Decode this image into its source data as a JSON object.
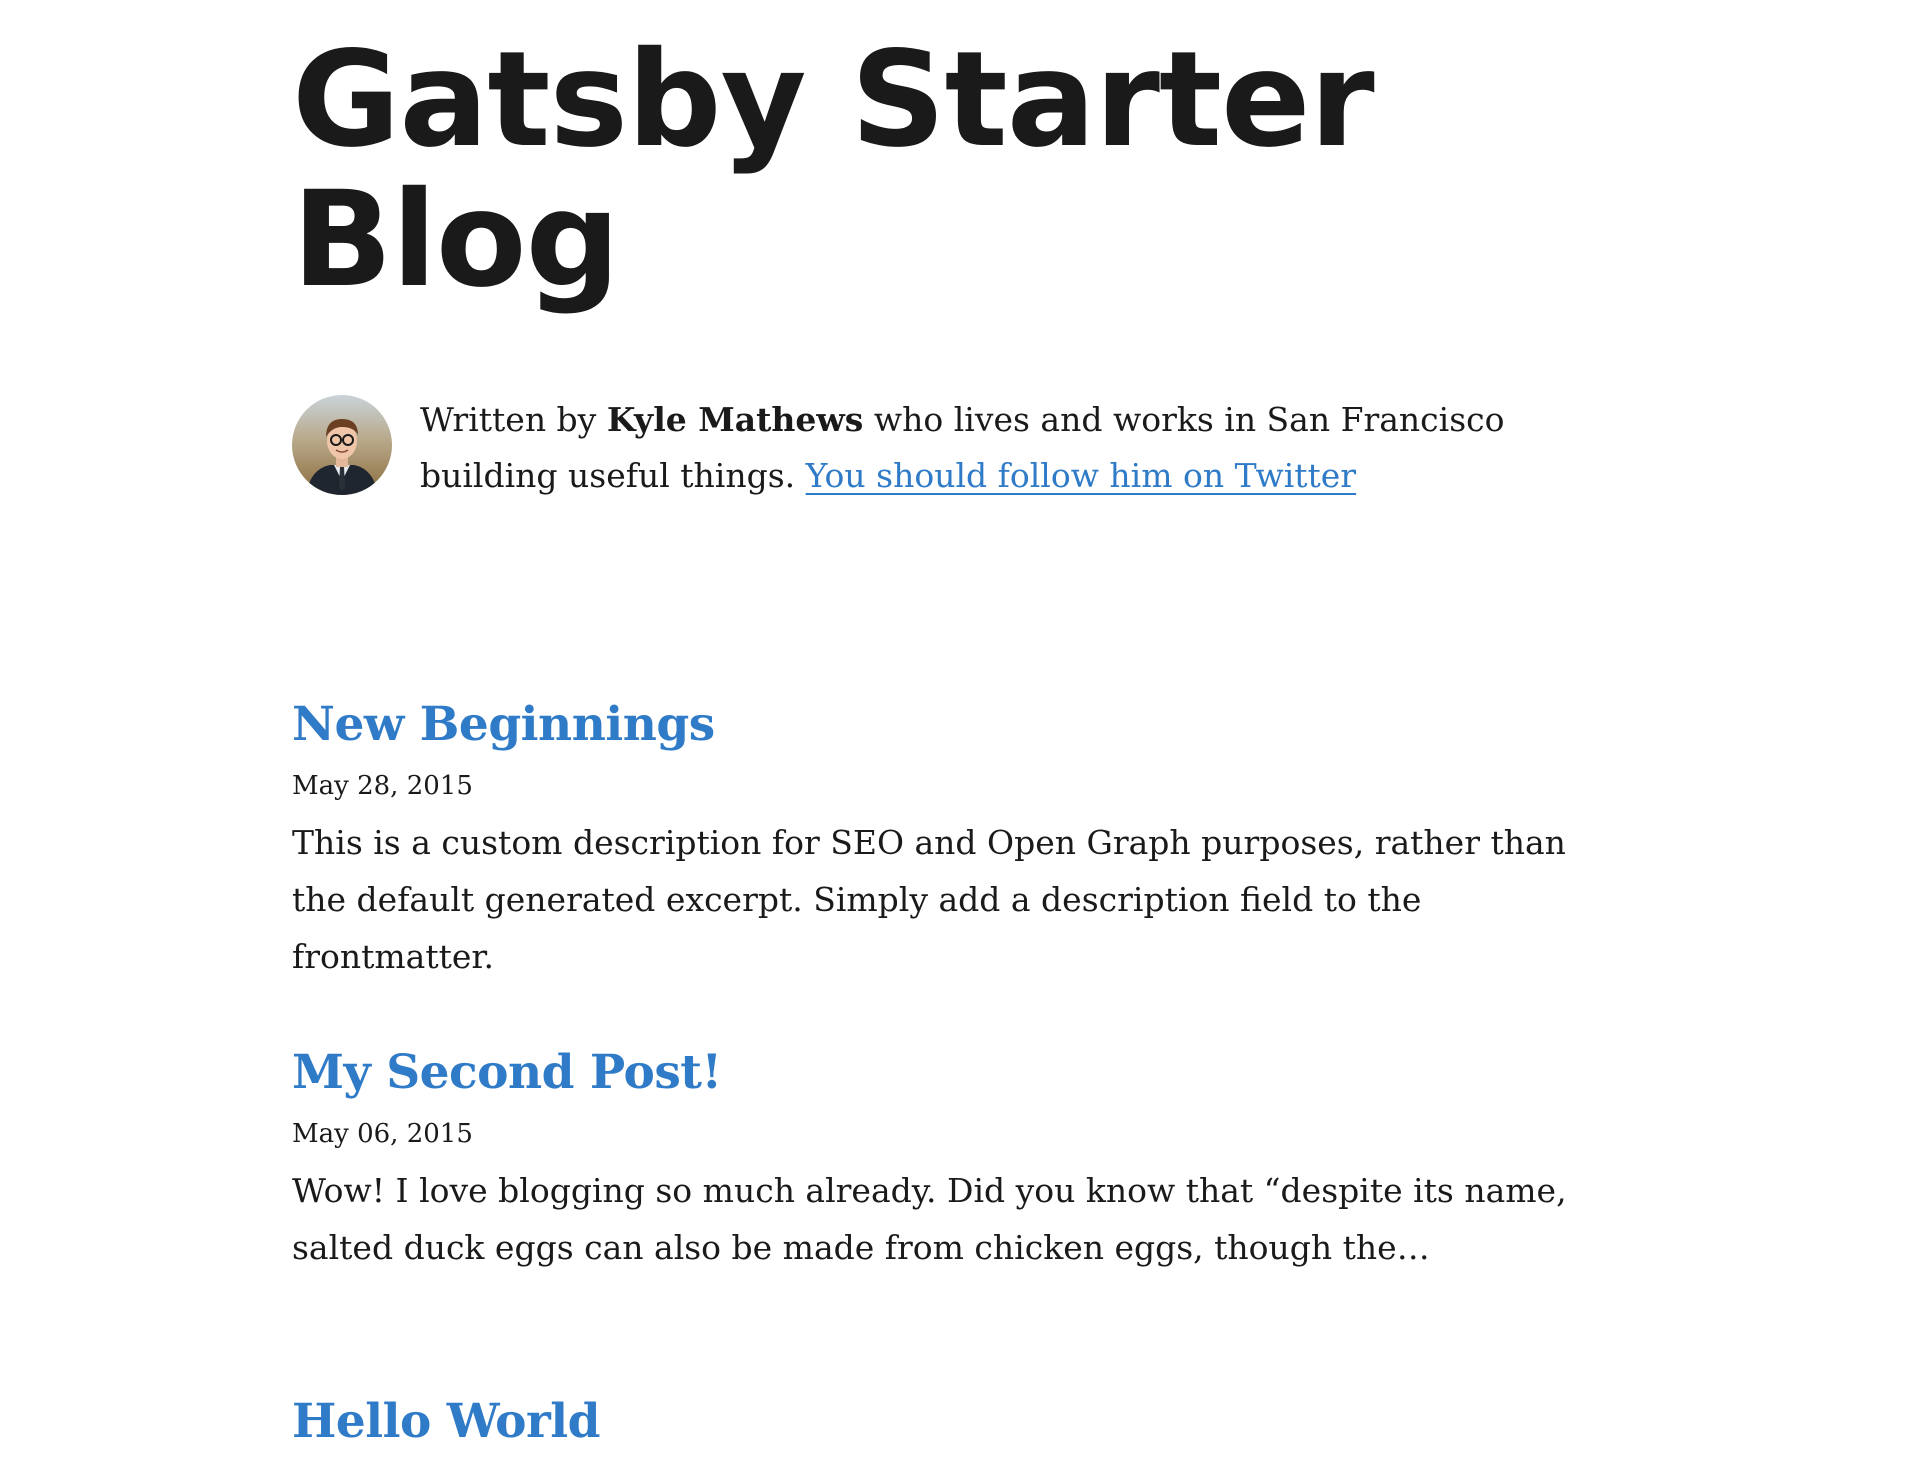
{
  "header": {
    "title": "Gatsby Starter Blog"
  },
  "bio": {
    "prefix": "Written by ",
    "author": "Kyle Mathews",
    "suffix": " who lives and works in San Francisco building useful things. ",
    "link_label": "You should follow him on Twitter"
  },
  "posts": [
    {
      "title": "New Beginnings",
      "date": "May 28, 2015",
      "excerpt": "This is a custom description for SEO and Open Graph purposes, rather than the default generated excerpt. Simply add a description field to the frontmatter."
    },
    {
      "title": "My Second Post!",
      "date": "May 06, 2015",
      "excerpt": "Wow! I love blogging so much already. Did you know that “despite its name, salted duck eggs can also be made from chicken eggs, though the…"
    },
    {
      "title": "Hello World",
      "date": "",
      "excerpt": ""
    }
  ],
  "colors": {
    "link": "#2f7bc7",
    "text": "#1a1a1a",
    "background": "#ffffff"
  }
}
